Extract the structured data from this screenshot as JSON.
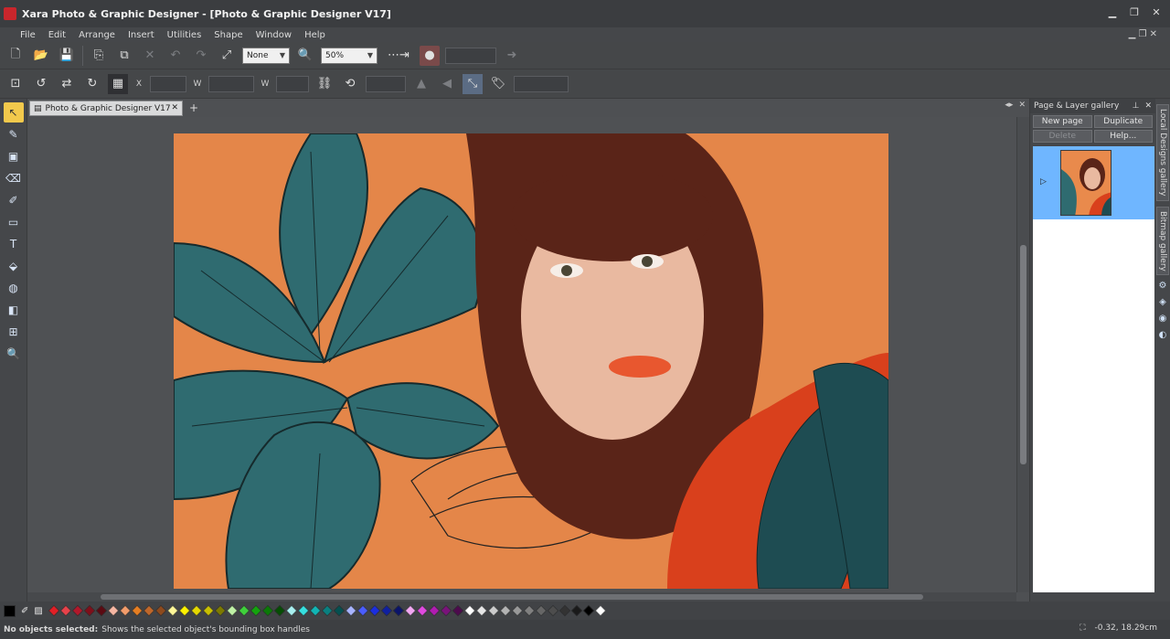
{
  "window": {
    "title": "Xara Photo & Graphic Designer - [Photo & Graphic Designer V17]"
  },
  "menu": [
    "File",
    "Edit",
    "Arrange",
    "Insert",
    "Utilities",
    "Shape",
    "Window",
    "Help"
  ],
  "toolbar": {
    "quality_combo": "None",
    "zoom_combo": "50%"
  },
  "infobar": {
    "x_label": "X",
    "y_label": "Y",
    "w_label": "W",
    "h_label": "H"
  },
  "document": {
    "tab_label": "Photo & Graphic Designer V17",
    "tab_close": "✕",
    "tab_add": "+"
  },
  "gallery": {
    "title": "Page & Layer gallery",
    "buttons": {
      "new_page": "New page",
      "duplicate": "Duplicate",
      "delete": "Delete",
      "help": "Help..."
    },
    "side_tabs": [
      "Local Designs gallery",
      "Bitmap gallery"
    ]
  },
  "status": {
    "bold": "No objects selected:",
    "message": "Shows the selected object's bounding box handles",
    "right_coords": "-0.32, 18.29cm"
  },
  "colors": {
    "accent_tool": "#f2c94c",
    "gallery_selected": "#6fb6ff",
    "swatches": [
      "#e21f26",
      "#e8424a",
      "#b2182b",
      "#7f0f1a",
      "#5c0a12",
      "#f7b7a3",
      "#f39c6b",
      "#e67e22",
      "#c0672a",
      "#8e4a1d",
      "#fff799",
      "#fff200",
      "#e5d800",
      "#c9c000",
      "#7d7a00",
      "#bff2a6",
      "#3fd13b",
      "#14a40e",
      "#0b7a07",
      "#064d04",
      "#a9f0f0",
      "#36e0e0",
      "#11b5b5",
      "#0a8080",
      "#055050",
      "#a8b4ff",
      "#4a5dff",
      "#1b2ee0",
      "#1020a0",
      "#0b146a",
      "#f2a8f2",
      "#e04ae0",
      "#b11cb1",
      "#7a137a",
      "#4d0b4d",
      "#ffffff",
      "#e6e6e6",
      "#cccccc",
      "#b3b3b3",
      "#999999",
      "#808080",
      "#666666",
      "#4d4d4d",
      "#333333",
      "#1a1a1a",
      "#000000",
      "#ffffff"
    ]
  }
}
